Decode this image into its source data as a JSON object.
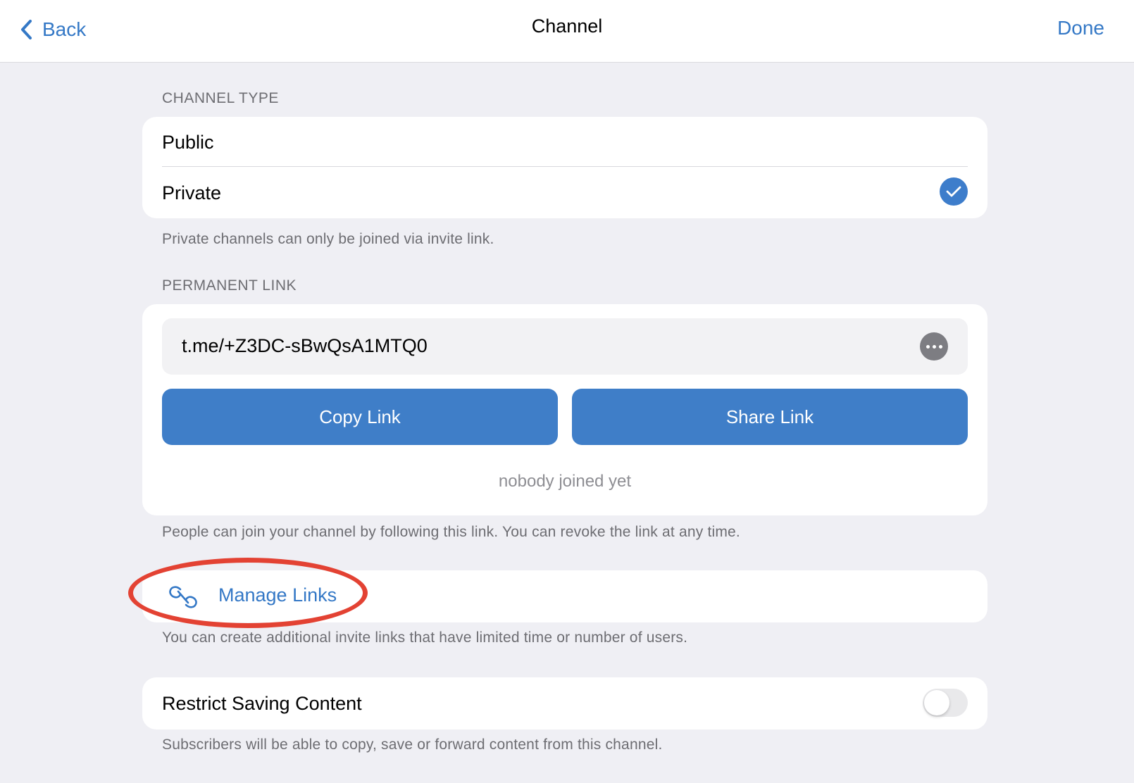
{
  "navbar": {
    "back_label": "Back",
    "title": "Channel",
    "done_label": "Done"
  },
  "channel_type": {
    "header": "CHANNEL TYPE",
    "options": [
      {
        "label": "Public",
        "selected": false
      },
      {
        "label": "Private",
        "selected": true
      }
    ],
    "footer": "Private channels can only be joined via invite link."
  },
  "permanent_link": {
    "header": "PERMANENT LINK",
    "link": "t.me/+Z3DC-sBwQsA1MTQ0",
    "copy_label": "Copy Link",
    "share_label": "Share Link",
    "joined_status": "nobody joined yet",
    "footer": "People can join your channel by following this link. You can revoke the link at any time."
  },
  "manage_links": {
    "label": "Manage Links",
    "icon": "link-icon",
    "footer": "You can create additional invite links that have limited time or number of users."
  },
  "restrict_saving": {
    "label": "Restrict Saving Content",
    "enabled": false,
    "footer": "Subscribers will be able to copy, save or forward content from this channel."
  },
  "colors": {
    "accent": "#3478c6",
    "button": "#3f7ec8",
    "background": "#efeff4",
    "annotation": "#e34233"
  }
}
